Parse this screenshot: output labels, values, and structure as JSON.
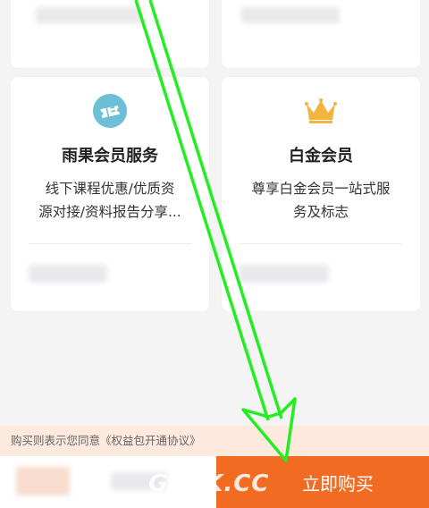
{
  "cards": [
    {
      "icon": "coupon-ticket-icon",
      "title": "雨果会员服务",
      "desc_line1": "线下课程优惠/优质资",
      "desc_line2": "源对接/资料报告分享..."
    },
    {
      "icon": "crown-icon",
      "title": "白金会员",
      "desc_line1": "尊享白金会员一站式服",
      "desc_line2": "务及标志"
    }
  ],
  "agreement_text": "购买则表示您同意《权益包开通协议》",
  "buy_button_label": "立即购买",
  "watermark": "GASK.CC",
  "colors": {
    "accent": "#f26b22",
    "agreement_bg": "#fde9de",
    "arrow": "#22ee22",
    "icon_circle": "#6cbfd6",
    "crown": "#f2b440"
  }
}
